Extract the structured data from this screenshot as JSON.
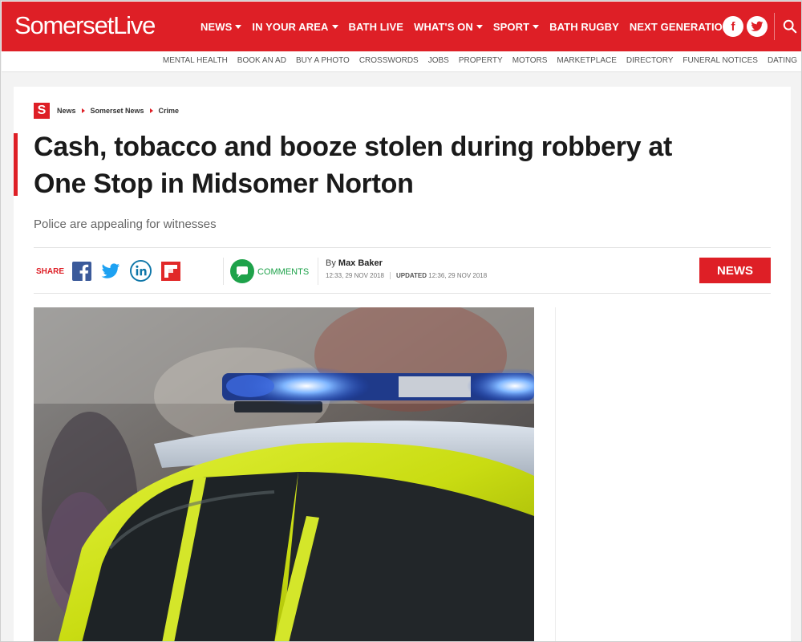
{
  "brand": {
    "name_part1": "Somerset",
    "name_part2": "Live",
    "color_primary": "#de1f26"
  },
  "nav": {
    "items": [
      {
        "label": "NEWS",
        "has_dropdown": true
      },
      {
        "label": "IN YOUR AREA",
        "has_dropdown": true
      },
      {
        "label": "BATH LIVE",
        "has_dropdown": false
      },
      {
        "label": "WHAT'S ON",
        "has_dropdown": true
      },
      {
        "label": "SPORT",
        "has_dropdown": true
      },
      {
        "label": "BATH RUGBY",
        "has_dropdown": false
      },
      {
        "label": "NEXT GENERATION",
        "has_dropdown": false
      }
    ],
    "social_icons": [
      "facebook-icon",
      "twitter-icon"
    ],
    "search_icon": "search-icon"
  },
  "subnav": {
    "items": [
      "MENTAL HEALTH",
      "BOOK AN AD",
      "BUY A PHOTO",
      "CROSSWORDS",
      "JOBS",
      "PROPERTY",
      "MOTORS",
      "MARKETPLACE",
      "DIRECTORY",
      "FUNERAL NOTICES",
      "DATING"
    ]
  },
  "article": {
    "badge": "S",
    "breadcrumbs": [
      "News",
      "Somerset News",
      "Crime"
    ],
    "headline_line1": "Cash, tobacco and booze stolen during robbery at",
    "headline_line2": "One Stop in Midsomer Norton",
    "standfirst": "Police are appealing for witnesses",
    "share_label": "SHARE",
    "share_icons": [
      "facebook-icon",
      "twitter-icon",
      "linkedin-icon",
      "flipboard-icon"
    ],
    "comments_label": "COMMENTS",
    "byline_prefix": "By",
    "author": "Max Baker",
    "published": "12:33, 29 NOV 2018",
    "updated_label": "UPDATED",
    "updated": "12:36, 29 NOV 2018",
    "category_tag": "NEWS",
    "hero_image_subject": "police car with blue lights"
  }
}
